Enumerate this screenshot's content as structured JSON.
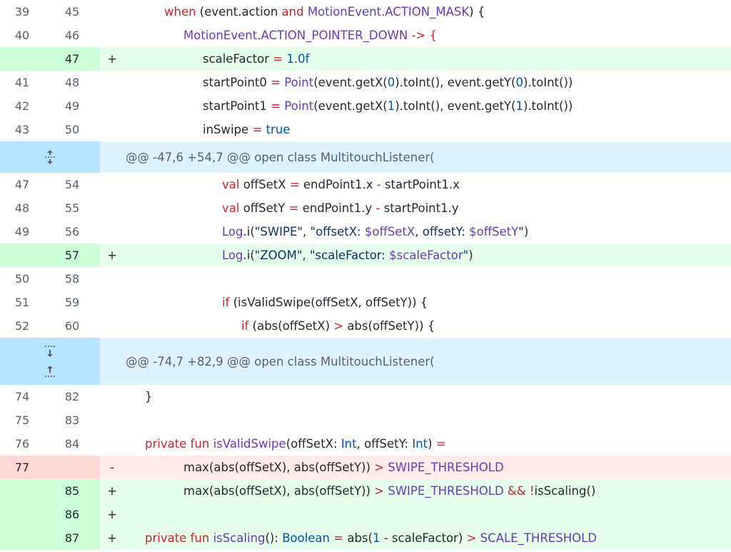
{
  "diff": {
    "block1": [
      {
        "type": "ctx",
        "old": "39",
        "new": "45",
        "sign": "",
        "indent": 230,
        "html": "when"
      },
      {
        "type": "ctx",
        "old": "40",
        "new": "46",
        "sign": "",
        "indent": 257
      },
      {
        "type": "add",
        "old": "",
        "new": "47",
        "sign": "+",
        "indent": 284
      },
      {
        "type": "ctx",
        "old": "41",
        "new": "48",
        "sign": "",
        "indent": 284
      },
      {
        "type": "ctx",
        "old": "42",
        "new": "49",
        "sign": "",
        "indent": 284
      },
      {
        "type": "ctx",
        "old": "43",
        "new": "50",
        "sign": "",
        "indent": 284
      }
    ],
    "hunk1": "@@ -47,6 +54,7 @@ open class MultitouchListener(",
    "block2": [
      {
        "old": "47",
        "new": "54"
      },
      {
        "old": "48",
        "new": "55"
      },
      {
        "old": "49",
        "new": "56"
      },
      {
        "old": "",
        "new": "57",
        "sign": "+"
      },
      {
        "old": "50",
        "new": "58"
      },
      {
        "old": "51",
        "new": "59"
      },
      {
        "old": "52",
        "new": "60"
      }
    ],
    "hunk2": "@@ -74,7 +82,9 @@ open class MultitouchListener(",
    "block3": [
      {
        "old": "74",
        "new": "82"
      },
      {
        "old": "75",
        "new": "83"
      },
      {
        "old": "76",
        "new": "84"
      },
      {
        "old": "77",
        "new": "",
        "sign": "-"
      },
      {
        "old": "",
        "new": "85",
        "sign": "+"
      },
      {
        "old": "",
        "new": "86",
        "sign": "+"
      },
      {
        "old": "",
        "new": "87",
        "sign": "+"
      }
    ],
    "tokens": {
      "when": "when",
      "event_action": " (event.action ",
      "and": "and",
      "motion_event": "MotionEvent",
      "action_mask": ".ACTION_MASK",
      "brace_open": ") {",
      "action_pointer_down": ".ACTION_POINTER_DOWN",
      "arrow": " -> {",
      "scale_factor": "scaleFactor",
      "eq": " = ",
      "one_f": "1.0f",
      "start_point0": "startPoint0",
      "start_point1": "startPoint1",
      "point": "Point",
      "get_x": "(event.getX(",
      "zero": "0",
      "one": "1",
      "to_int_get_y": ").toInt(), event.getY(",
      "to_int_end": ").toInt())",
      "in_swipe": "inSwipe",
      "true_kw": "true",
      "val": "val",
      "off_set_x_decl": " offSetX ",
      "off_set_y_decl": " offSetY ",
      "eq2": "= ",
      "end_point_x": "endPoint1.x ",
      "end_point_y": "endPoint1.y ",
      "minus": "-",
      "start_point_x": " startPoint1.x",
      "start_point_y": " startPoint1.y",
      "log": "Log",
      "dot_i": ".i(",
      "swipe_str": "\"SWIPE\"",
      "comma": ", ",
      "offset_x_str": "\"offsetX: ",
      "dollar_off_x": "$offSetX",
      "offset_y_mid": ", offsetY: ",
      "dollar_off_y": "$offSetY",
      "str_close": "\"",
      "paren_close": ")",
      "zoom_str": "\"ZOOM\"",
      "scale_factor_str": "\"scaleFactor: ",
      "dollar_scale": "$scaleFactor",
      "if_kw": "if",
      "is_valid_call": " (isValidSwipe(offSetX, offSetY)) {",
      "abs_x": " (abs(offSetX) ",
      "gt": ">",
      "abs_y": " abs(offSetY)) {",
      "close_brace": "}",
      "private_fun": "private fun ",
      "is_valid_swipe": "isValidSwipe",
      "params_a": "(offSetX: ",
      "int_type": "Int",
      "params_b": ", offSetY: ",
      "params_c": ") =",
      "max_abs": "max(abs(offSetX), abs(offSetY)) ",
      "swipe_threshold": "SWIPE_THRESHOLD",
      "and_and": "&&",
      "not": " !",
      "is_scaling_call": "isScaling()",
      "is_scaling": "isScaling",
      "colon_sp": "(): ",
      "boolean": "Boolean",
      "abs_one": "abs(",
      "minus_scale": " - scaleFactor) ",
      "scale_threshold": "SCALE_THRESHOLD",
      "space": " "
    }
  }
}
